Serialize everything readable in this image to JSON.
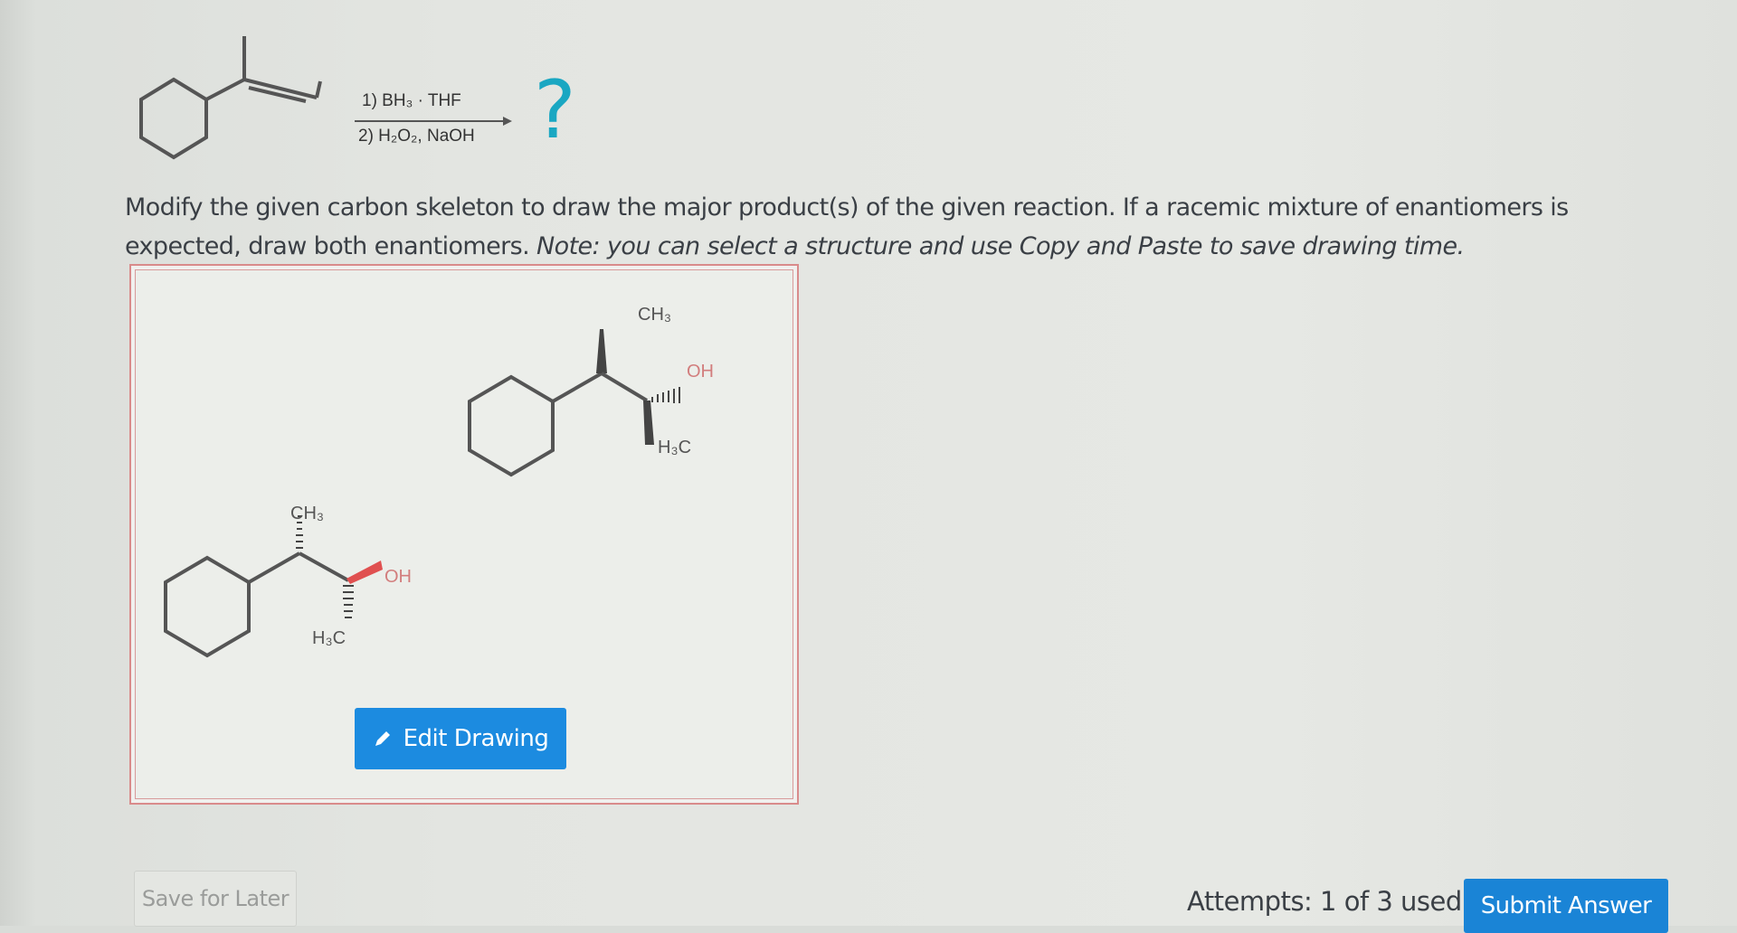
{
  "reaction": {
    "reagent_line_1": "1) BH₃ · THF",
    "reagent_line_2": "2) H₂O₂, NaOH",
    "question_mark": "?"
  },
  "instructions": {
    "main": "Modify the given carbon skeleton to draw the major product(s) of the given reaction. If a racemic mixture of enantiomers is expected, draw both enantiomers. ",
    "note": "Note: you can select a structure and use Copy and Paste to save drawing time."
  },
  "structures": {
    "product_1": {
      "ch3_label": "CH₃",
      "oh_label": "OH",
      "h3c_label": "H₃C"
    },
    "product_2": {
      "ch3_label": "CH₃",
      "oh_label": "OH",
      "h3c_label": "H₃C"
    }
  },
  "buttons": {
    "edit_drawing": "Edit Drawing",
    "save_for_later": "Save for Later",
    "submit_answer": "Submit Answer"
  },
  "status": {
    "attempts": "Attempts: 1 of 3 used"
  },
  "colors": {
    "question_mark": "#1aa7c2",
    "edit_button": "#1c8be0",
    "submit_button": "#1a84d6",
    "drawing_border": "#d98b8b",
    "oh_wedge": "#e05050"
  },
  "icons": {
    "edit_button_icon": "pencil-icon"
  }
}
